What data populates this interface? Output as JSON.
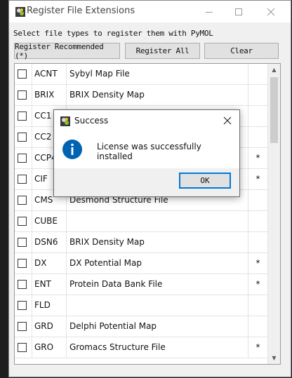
{
  "window": {
    "title": "Register File Extensions",
    "instruction": "Select file types to register them with PyMOL"
  },
  "buttons": {
    "register_recommended": "Register Recommended (*)",
    "register_all": "Register All",
    "clear": "Clear"
  },
  "rows": [
    {
      "ext": "ACNT",
      "desc": "Sybyl Map File",
      "rec": ""
    },
    {
      "ext": "BRIX",
      "desc": "BRIX Density Map",
      "rec": ""
    },
    {
      "ext": "CC1",
      "desc": "",
      "rec": ""
    },
    {
      "ext": "CC2",
      "desc": "",
      "rec": ""
    },
    {
      "ext": "CCP4",
      "desc": "",
      "rec": "*"
    },
    {
      "ext": "CIF",
      "desc": "",
      "rec": "*"
    },
    {
      "ext": "CMS",
      "desc": "Desmond Structure File",
      "rec": ""
    },
    {
      "ext": "CUBE",
      "desc": "",
      "rec": ""
    },
    {
      "ext": "DSN6",
      "desc": "BRIX Density Map",
      "rec": ""
    },
    {
      "ext": "DX",
      "desc": "DX Potential Map",
      "rec": "*"
    },
    {
      "ext": "ENT",
      "desc": "Protein Data Bank File",
      "rec": "*"
    },
    {
      "ext": "FLD",
      "desc": "",
      "rec": ""
    },
    {
      "ext": "GRD",
      "desc": "Delphi Potential Map",
      "rec": ""
    },
    {
      "ext": "GRO",
      "desc": "Gromacs Structure File",
      "rec": "*"
    }
  ],
  "dialog": {
    "title": "Success",
    "message": "License was successfully installed",
    "ok": "OK"
  },
  "colors": {
    "accent": "#0078d7",
    "info_icon": "#0063b1"
  }
}
